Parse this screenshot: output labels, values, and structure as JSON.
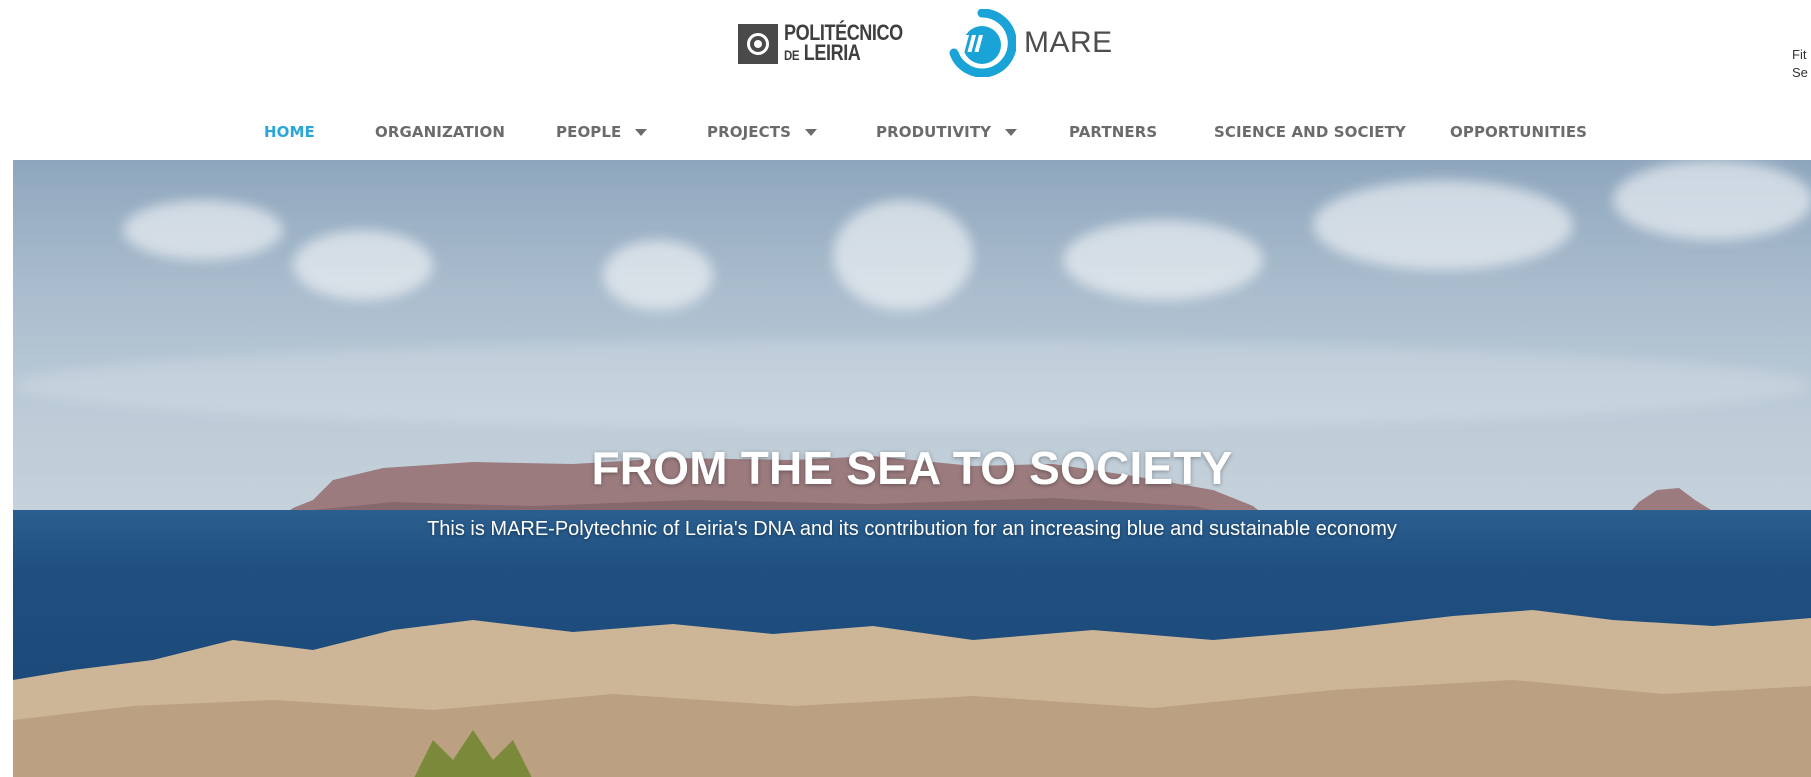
{
  "header": {
    "logo_ipl": {
      "line1": "POLITÉCNICO",
      "line2_prefix": "DE",
      "line2": "LEIRIA"
    },
    "logo_mare": {
      "text": "MARE"
    },
    "side_text": {
      "line1": "Fit",
      "line2": "Se"
    }
  },
  "nav": {
    "items": [
      {
        "label": "HOME",
        "active": true,
        "dropdown": false
      },
      {
        "label": "ORGANIZATION",
        "active": false,
        "dropdown": false
      },
      {
        "label": "PEOPLE",
        "active": false,
        "dropdown": true
      },
      {
        "label": "PROJECTS",
        "active": false,
        "dropdown": true
      },
      {
        "label": "PRODUTIVITY",
        "active": false,
        "dropdown": true
      },
      {
        "label": "PARTNERS",
        "active": false,
        "dropdown": false
      },
      {
        "label": "SCIENCE AND SOCIETY",
        "active": false,
        "dropdown": false
      },
      {
        "label": "OPPORTUNITIES",
        "active": false,
        "dropdown": false
      }
    ]
  },
  "hero": {
    "title": "FROM THE SEA TO SOCIETY",
    "subtitle": "This is MARE-Polytechnic of Leiria's DNA and its contribution for an increasing blue and sustainable economy"
  },
  "colors": {
    "accent": "#2aa7d8",
    "nav_text": "#6b6b6b",
    "logo_gray": "#4a4a4a"
  }
}
